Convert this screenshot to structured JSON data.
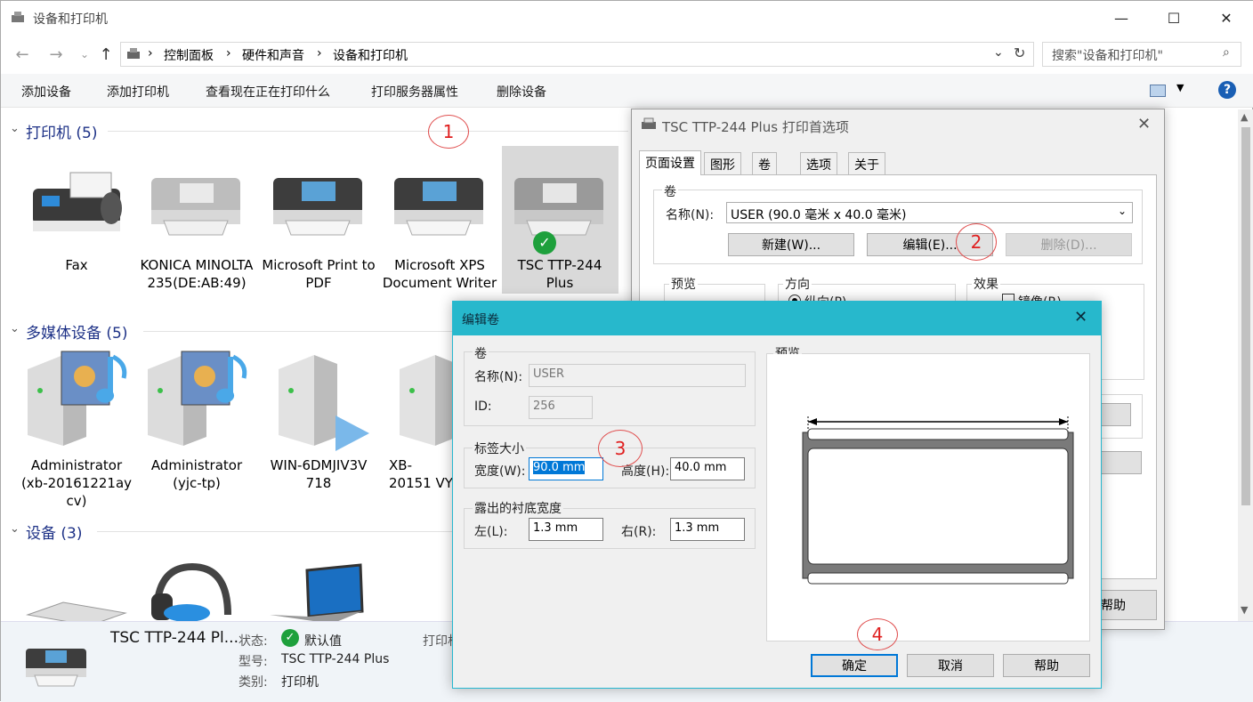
{
  "window": {
    "title": "设备和打印机"
  },
  "breadcrumb": [
    "控制面板",
    "硬件和声音",
    "设备和打印机"
  ],
  "search": {
    "placeholder": "搜索\"设备和打印机\""
  },
  "commands": [
    "添加设备",
    "添加打印机",
    "查看现在正在打印什么",
    "打印服务器属性",
    "删除设备"
  ],
  "groups": {
    "printers": {
      "label": "打印机 (5)",
      "items": [
        "Fax",
        "KONICA MINOLTA 235(DE:AB:49)",
        "Microsoft Print to PDF",
        "Microsoft XPS Document Writer",
        "TSC TTP-244 Plus"
      ]
    },
    "media": {
      "label": "多媒体设备 (5)",
      "items": [
        "Administrator (xb-20161221ay cv)",
        "Administrator (yjc-tp)",
        "WIN-6DMJIV3V 718",
        "XB-20151 VY"
      ]
    },
    "devices": {
      "label": "设备 (3)"
    }
  },
  "annotations": [
    "1",
    "2",
    "3",
    "4"
  ],
  "status": {
    "name": "TSC TTP-244 Pl...",
    "state_label": "状态:",
    "state_value": "默认值",
    "model_label": "型号:",
    "model_value": "TSC TTP-244 Plus",
    "category_label": "类别:",
    "category_value": "打印机",
    "extra": "打印机"
  },
  "prefs": {
    "title": "TSC TTP-244 Plus 打印首选项",
    "tabs": [
      "页面设置",
      "图形",
      "卷",
      "选项",
      "关于"
    ],
    "roll_group": "卷",
    "name_label": "名称(N):",
    "name_value": "USER (90.0 毫米 x 40.0 毫米)",
    "new_btn": "新建(W)...",
    "edit_btn": "编辑(E)...",
    "delete_btn": "删除(D)...",
    "preview_label": "预览",
    "orientation_label": "方向",
    "orientation_value": "纵向(P)",
    "effect_label": "效果",
    "mirror_label": "镜像(R)",
    "help_btn": "帮助"
  },
  "edit": {
    "title": "编辑卷",
    "roll_group": "卷",
    "name_label": "名称(N):",
    "name_value": "USER",
    "id_label": "ID:",
    "id_value": "256",
    "size_group": "标签大小",
    "width_label": "宽度(W):",
    "width_value": "90.0 mm",
    "height_label": "高度(H):",
    "height_value": "40.0 mm",
    "liner_group": "露出的衬底宽度",
    "left_label": "左(L):",
    "left_value": "1.3 mm",
    "right_label": "右(R):",
    "right_value": "1.3 mm",
    "preview_label": "预览",
    "ok": "确定",
    "cancel": "取消",
    "help": "帮助"
  }
}
